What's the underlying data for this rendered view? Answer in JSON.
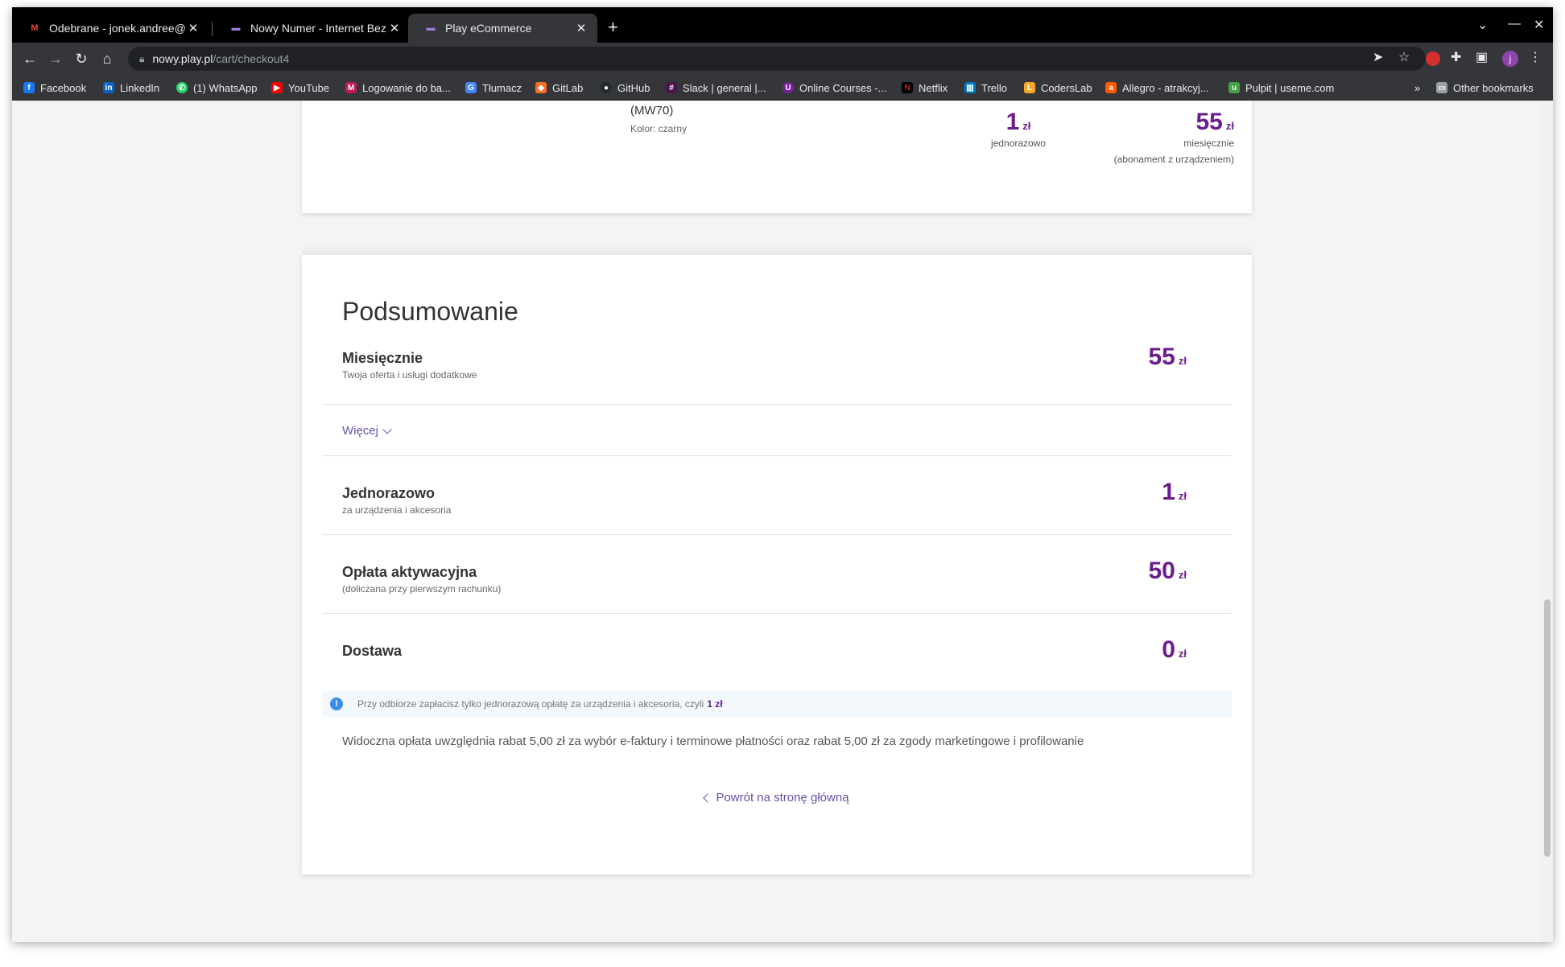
{
  "browser": {
    "tabs": [
      {
        "title": "Odebrane - jonek.andree@gm",
        "icon": "gmail-icon",
        "active": false
      },
      {
        "title": "Nowy Numer - Internet Bezpr",
        "icon": "play-icon",
        "active": false
      },
      {
        "title": "Play eCommerce",
        "icon": "play-icon",
        "active": true
      }
    ],
    "url_host": "nowy.play.pl",
    "url_path": "/cart/checkout4",
    "profile_initial": "j",
    "bookmarks": [
      {
        "label": "Facebook",
        "color": "#1877f2"
      },
      {
        "label": "LinkedIn",
        "color": "#0a66c2"
      },
      {
        "label": "(1) WhatsApp",
        "color": "#25d366"
      },
      {
        "label": "YouTube",
        "color": "#ff0000"
      },
      {
        "label": "Logowanie do ba...",
        "color": "#c2185b"
      },
      {
        "label": "Tłumacz",
        "color": "#4285f4"
      },
      {
        "label": "GitLab",
        "color": "#fc6d26"
      },
      {
        "label": "GitHub",
        "color": "#24292e"
      },
      {
        "label": "Slack | general |...",
        "color": "#4a154b"
      },
      {
        "label": "Online Courses -...",
        "color": "#7b1fa2"
      },
      {
        "label": "Netflix",
        "color": "#e50914"
      },
      {
        "label": "Trello",
        "color": "#0079bf"
      },
      {
        "label": "CodersLab",
        "color": "#f9a825"
      },
      {
        "label": "Allegro - atrakcyj...",
        "color": "#ff5a00"
      },
      {
        "label": "Pulpit | useme.com",
        "color": "#43a047"
      }
    ],
    "other_bookmarks": "Other bookmarks"
  },
  "product": {
    "name_tail": "(MW70)",
    "color_label": "Kolor: czarny",
    "onetime_value": "1",
    "onetime_unit": "zł",
    "onetime_label": "jednorazowo",
    "monthly_value": "55",
    "monthly_unit": "zł",
    "monthly_label": "miesięcznie",
    "monthly_note": "(abonament z urządzeniem)"
  },
  "summary": {
    "title": "Podsumowanie",
    "monthly": {
      "label": "Miesięcznie",
      "desc": "Twoja oferta i usługi dodatkowe",
      "value": "55",
      "unit": "zł"
    },
    "more_label": "Więcej",
    "onetime": {
      "label": "Jednorazowo",
      "desc": "za urządzenia i akcesoria",
      "value": "1",
      "unit": "zł"
    },
    "activation": {
      "label": "Opłata aktywacyjna",
      "desc": "(doliczana przy pierwszym rachunku)",
      "value": "50",
      "unit": "zł"
    },
    "delivery": {
      "label": "Dostawa",
      "value": "0",
      "unit": "zł"
    },
    "info_text": "Przy odbiorze zapłacisz tylko jednorazową opłatę za urządzenia i akcesoria, czyli",
    "info_amount": "1 zł",
    "disclaimer": "Widoczna opłata uwzględnia rabat 5,00 zł za wybór e-faktury i terminowe płatności oraz rabat 5,00 zł za zgody marketingowe i profilowanie",
    "back_label": "Powrót na stronę główną"
  },
  "colors": {
    "accent_purple": "#6b1d8c",
    "link_purple": "#6b4fa8",
    "info_blue": "#3b8ee8"
  }
}
